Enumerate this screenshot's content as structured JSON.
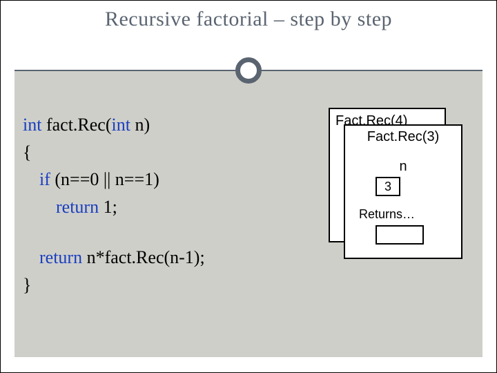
{
  "title": "Recursive factorial – step by step",
  "code": {
    "l1_kw1": "int",
    "l1_fn": " fact.Rec(",
    "l1_kw2": "int",
    "l1_end": " n)",
    "l2": "{",
    "l3_kw": "if",
    "l3_rest": " (n==0 || n==1)",
    "l4_kw": "return",
    "l4_rest": " 1;",
    "l5_kw": "return",
    "l5_rest": " n*fact.Rec(n-1);",
    "l6": "}"
  },
  "stack": {
    "back_title": "Fact.Rec(4)",
    "front_title": "Fact.Rec(3)",
    "var_label": "n",
    "var_value": "3",
    "returns_label": "Returns…",
    "returns_value": ""
  }
}
